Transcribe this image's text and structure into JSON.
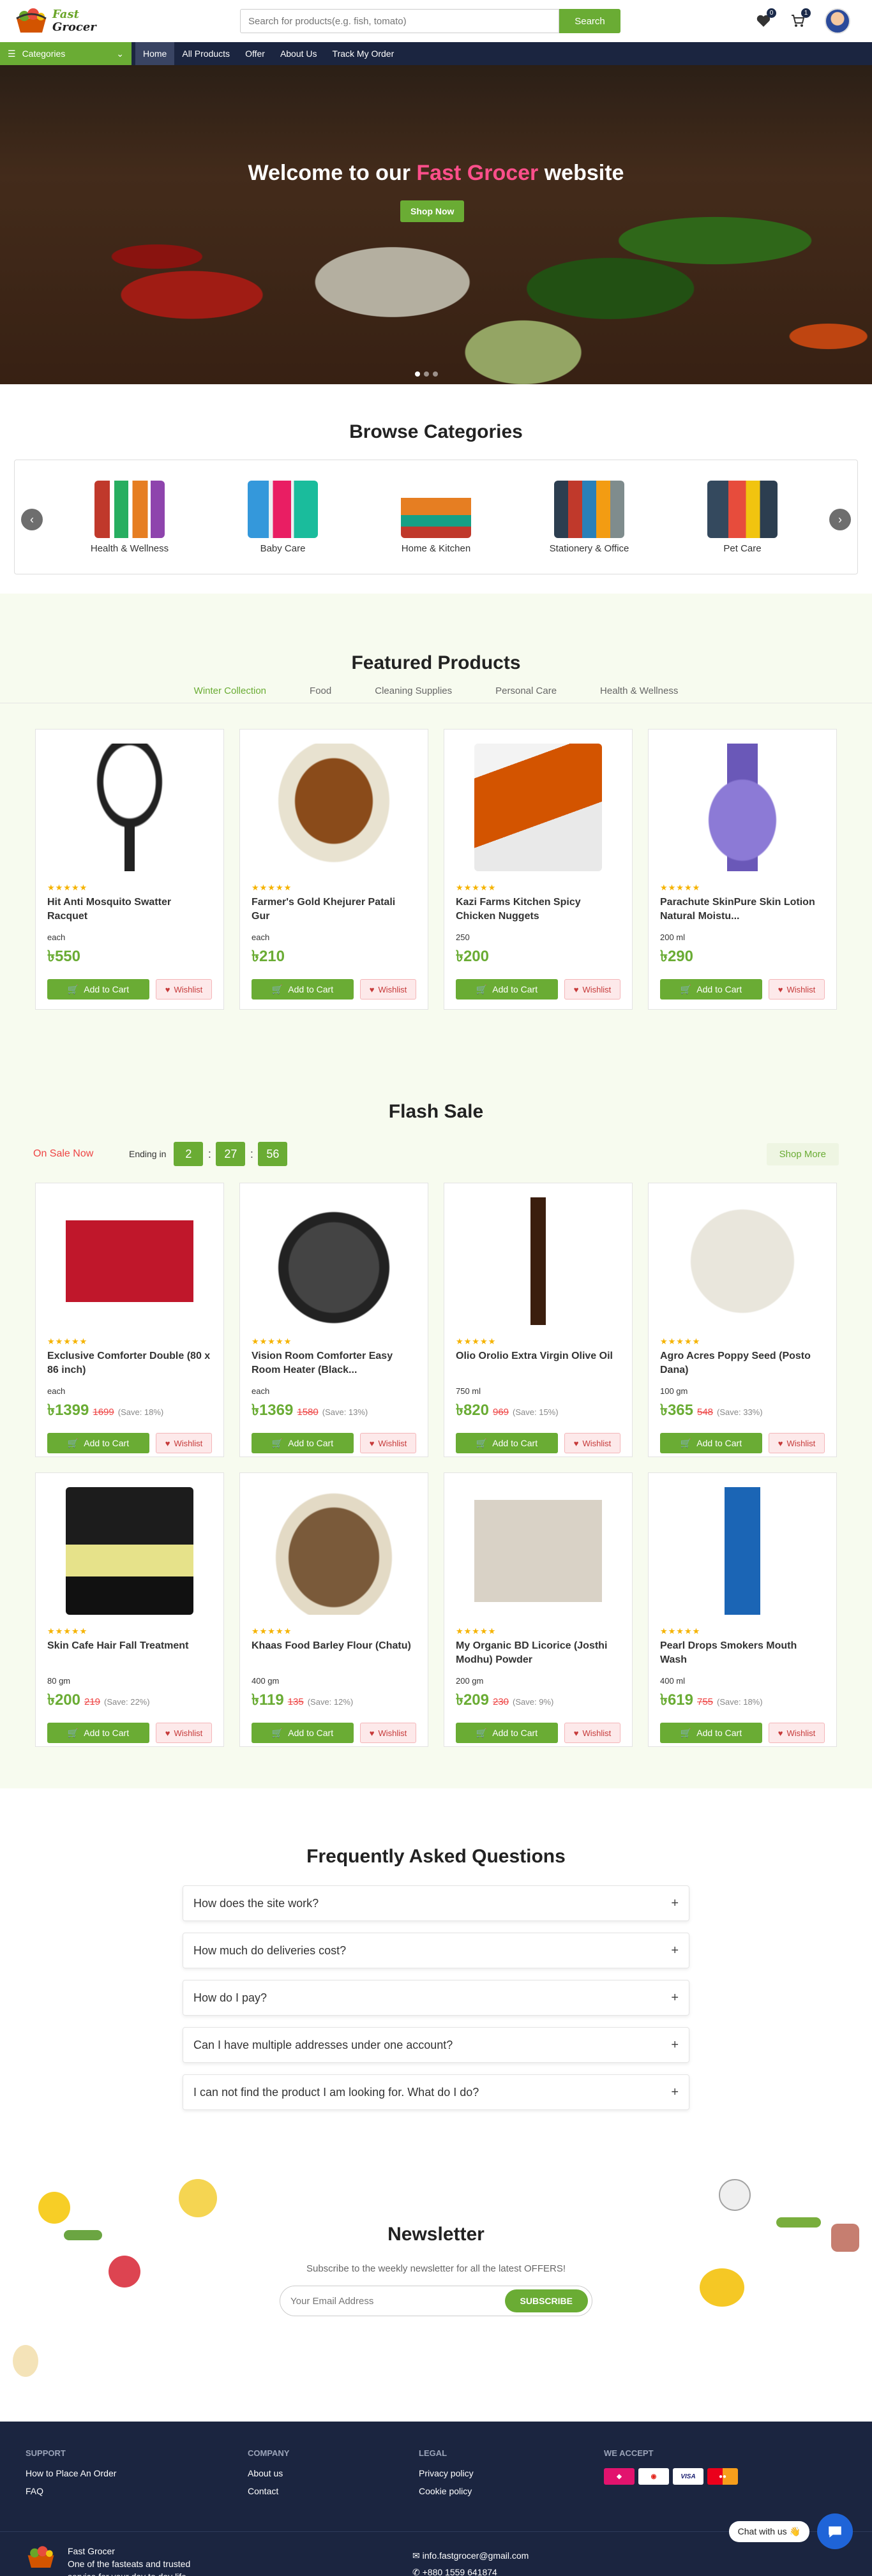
{
  "header": {
    "logo_line1": "Fast",
    "logo_line2": "Grocer",
    "search_placeholder": "Search for products(e.g. fish, tomato)",
    "search_button": "Search",
    "wishlist_count": "0",
    "cart_count": "1"
  },
  "nav": {
    "categories_label": "Categories",
    "links": [
      "Home",
      "All Products",
      "Offer",
      "About Us",
      "Track My Order"
    ]
  },
  "hero": {
    "title_before": "Welcome to our ",
    "title_accent": "Fast Grocer",
    "title_after": " website",
    "button": "Shop Now"
  },
  "browse": {
    "title": "Browse Categories",
    "items": [
      "Health & Wellness",
      "Baby Care",
      "Home & Kitchen",
      "Stationery & Office",
      "Pet Care"
    ]
  },
  "featured": {
    "title": "Featured Products",
    "tabs": [
      "Winter Collection",
      "Food",
      "Cleaning Supplies",
      "Personal Care",
      "Health & Wellness"
    ],
    "products": [
      {
        "name": "Hit Anti Mosquito Swatter Racquet",
        "unit": "each",
        "price": "৳550"
      },
      {
        "name": "Farmer's Gold Khejurer Patali Gur",
        "unit": "each",
        "price": "৳210"
      },
      {
        "name": "Kazi Farms Kitchen Spicy Chicken Nuggets",
        "unit": "250",
        "price": "৳200"
      },
      {
        "name": "Parachute SkinPure Skin Lotion Natural Moistu...",
        "unit": "200 ml",
        "price": "৳290"
      }
    ]
  },
  "card_labels": {
    "add_to_cart": "Add to Cart",
    "wishlist": "Wishlist",
    "stars": "★★★★★"
  },
  "flash": {
    "title": "Flash Sale",
    "on_sale": "On Sale Now",
    "ending_label": "Ending in",
    "timer": [
      "2",
      "27",
      "56"
    ],
    "shop_more": "Shop More",
    "products": [
      {
        "name": "Exclusive Comforter Double (80 x 86 inch)",
        "unit": "each",
        "price": "৳1399",
        "old": "1699",
        "save": "(Save: 18%)"
      },
      {
        "name": "Vision Room Comforter Easy Room Heater (Black...",
        "unit": "each",
        "price": "৳1369",
        "old": "1580",
        "save": "(Save: 13%)"
      },
      {
        "name": "Olio Orolio Extra Virgin Olive Oil",
        "unit": "750 ml",
        "price": "৳820",
        "old": "969",
        "save": "(Save: 15%)"
      },
      {
        "name": "Agro Acres Poppy Seed (Posto Dana)",
        "unit": "100 gm",
        "price": "৳365",
        "old": "548",
        "save": "(Save: 33%)"
      },
      {
        "name": "Skin Cafe Hair Fall Treatment",
        "unit": "80 gm",
        "price": "৳200",
        "old": "219",
        "save": "(Save: 22%)"
      },
      {
        "name": "Khaas Food Barley Flour (Chatu)",
        "unit": "400 gm",
        "price": "৳119",
        "old": "135",
        "save": "(Save: 12%)"
      },
      {
        "name": "My Organic BD Licorice (Josthi Modhu) Powder",
        "unit": "200 gm",
        "price": "৳209",
        "old": "230",
        "save": "(Save: 9%)"
      },
      {
        "name": "Pearl Drops Smokers Mouth Wash",
        "unit": "400 ml",
        "price": "৳619",
        "old": "755",
        "save": "(Save: 18%)"
      }
    ]
  },
  "faq": {
    "title": "Frequently Asked Questions",
    "items": [
      "How does the site work?",
      "How much do deliveries cost?",
      "How do I pay?",
      "Can I have multiple addresses under one account?",
      "I can not find the product I am looking for. What do I do?"
    ]
  },
  "newsletter": {
    "title": "Newsletter",
    "subtitle": "Subscribe to the weekly newsletter for all the latest OFFERS!",
    "placeholder": "Your Email Address",
    "button": "SUBSCRIBE"
  },
  "footer": {
    "support_head": "SUPPORT",
    "support_links": [
      "How to Place An Order",
      "FAQ"
    ],
    "company_head": "COMPANY",
    "company_links": [
      "About us",
      "Contact"
    ],
    "legal_head": "LEGAL",
    "legal_links": [
      "Privacy policy",
      "Cookie policy"
    ],
    "accept_head": "WE ACCEPT",
    "brand_name": "Fast Grocer",
    "brand_tag": "One of the fasteats and trusted service for your day to day life.",
    "email": "info.fastgrocer@gmail.com",
    "phone": "+880 1559 641874",
    "chat": "Chat with us 👋"
  },
  "colors": {
    "brand_green": "#6aac34",
    "nav_dark": "#1b2540",
    "accent_pink": "#ff4f8b",
    "sale_red": "#e44"
  }
}
